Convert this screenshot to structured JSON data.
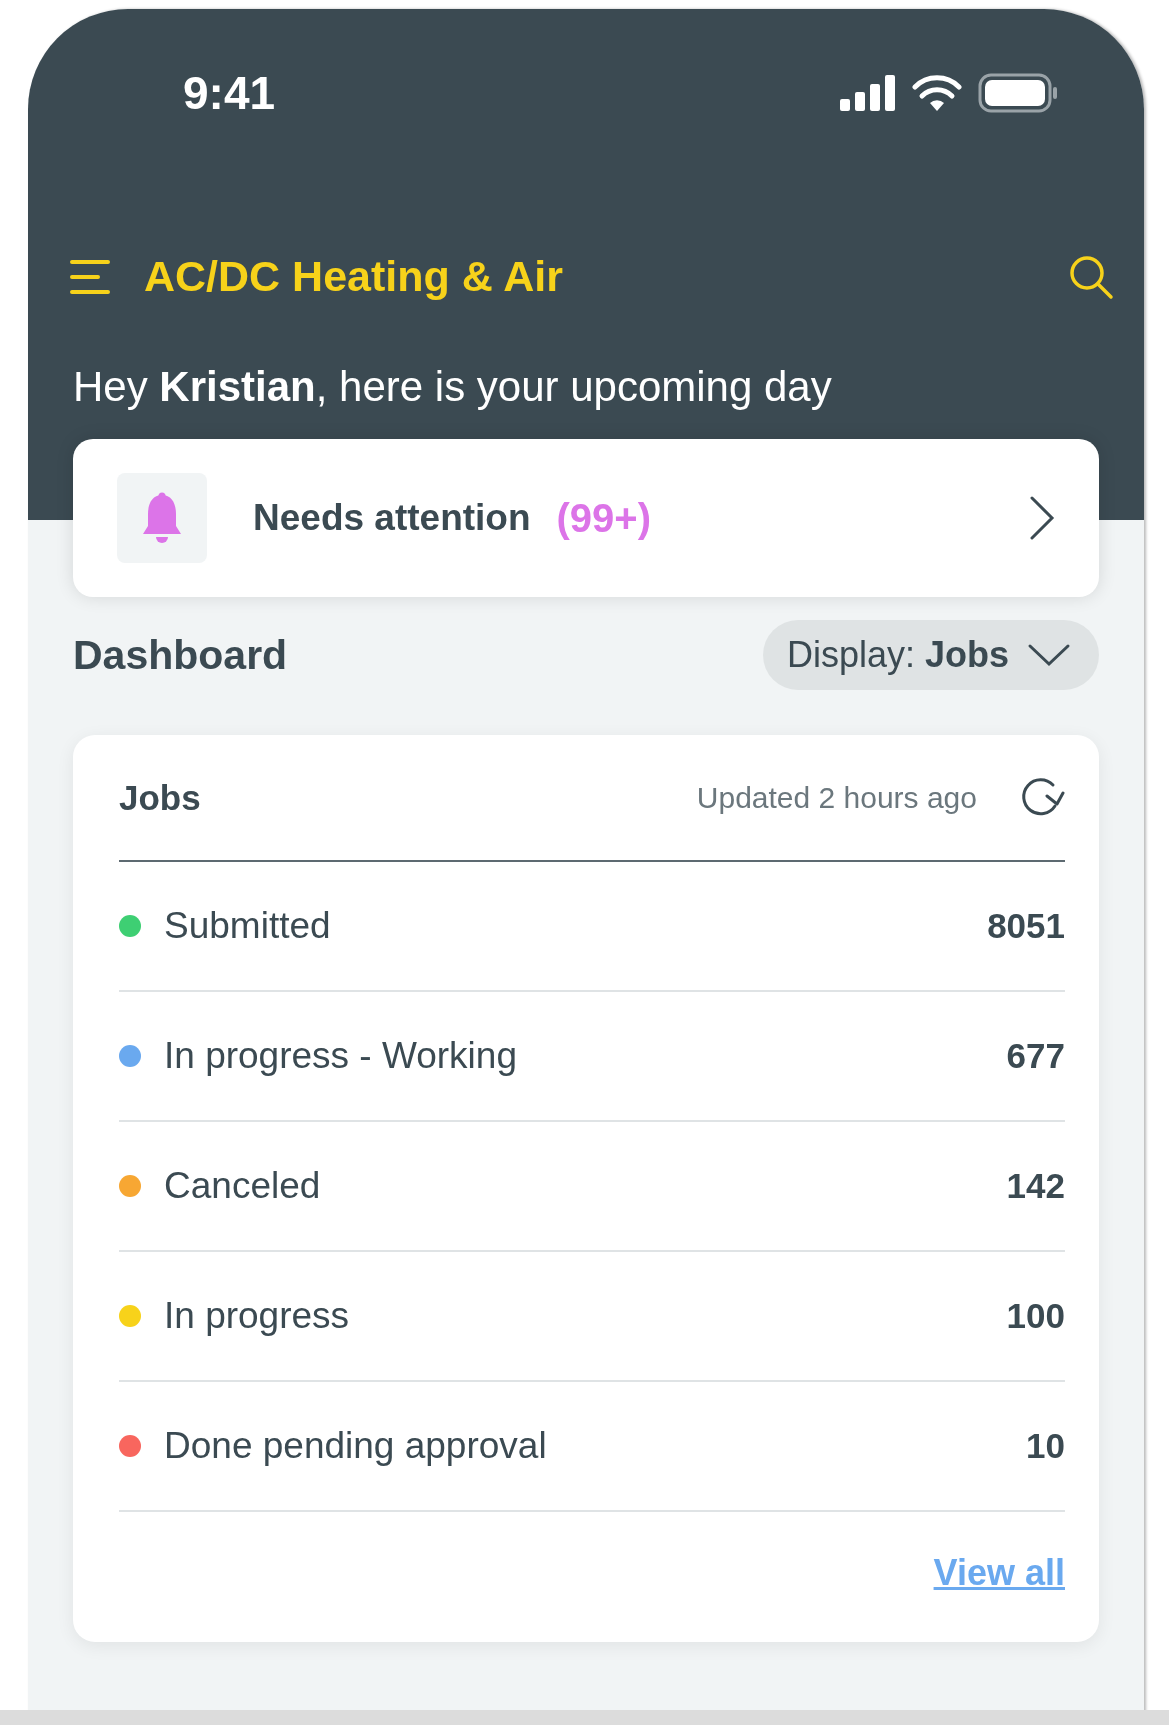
{
  "status_bar": {
    "time": "9:41"
  },
  "app_bar": {
    "title": "AC/DC Heating & Air"
  },
  "greeting": "Hey **Kristian**, here is your upcoming day",
  "attention": {
    "label": "Needs attention",
    "count": "(99+)"
  },
  "dashboard": {
    "title": "Dashboard",
    "display_label": "Display:",
    "display_value": "Jobs"
  },
  "jobs_card": {
    "title": "Jobs",
    "updated": "Updated 2 hours ago",
    "rows": [
      {
        "label": "Submitted",
        "count": "8051",
        "color": "#3ecf73"
      },
      {
        "label": "In progress - Working",
        "count": "677",
        "color": "#6aa9ef"
      },
      {
        "label": "Canceled",
        "count": "142",
        "color": "#f7a733"
      },
      {
        "label": "In progress",
        "count": "100",
        "color": "#f7d21a"
      },
      {
        "label": "Done pending approval",
        "count": "10",
        "color": "#f8665e"
      }
    ],
    "link": "View all"
  }
}
